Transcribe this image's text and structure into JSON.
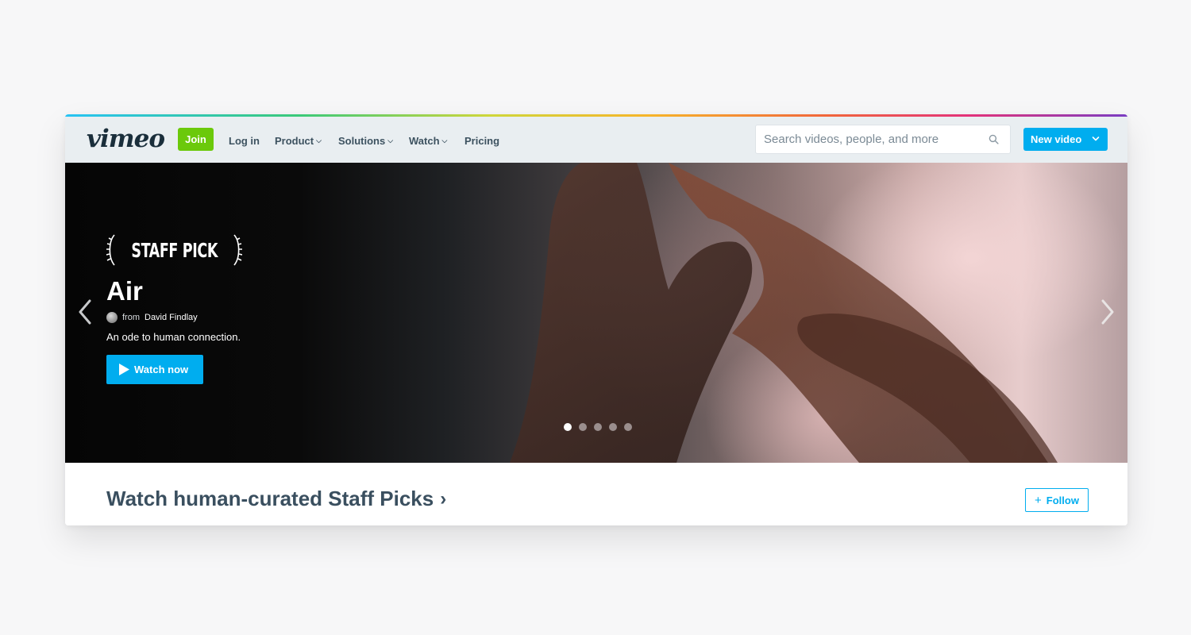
{
  "header": {
    "logo": "vimeo",
    "join_label": "Join",
    "nav": [
      {
        "label": "Log in"
      },
      {
        "label": "Product",
        "has_chevron": true
      },
      {
        "label": "Solutions",
        "has_chevron": true
      },
      {
        "label": "Watch",
        "has_chevron": true
      },
      {
        "label": "Pricing"
      }
    ],
    "search_placeholder": "Search videos, people, and more",
    "new_video_label": "New video"
  },
  "hero": {
    "badge": "STAFF PICK",
    "title": "Air",
    "byline_prefix": "from",
    "author": "David Findlay",
    "description": "An ode to human connection.",
    "watch_label": "Watch now",
    "carousel": {
      "total": 5,
      "active_index": 0
    }
  },
  "section": {
    "title": "Watch human-curated Staff Picks",
    "chevron": "›",
    "follow_plus": "+",
    "follow_label": "Follow"
  },
  "colors": {
    "join_green": "#6bc90b",
    "vimeo_blue": "#00adef",
    "nav_text": "#3d5260",
    "header_bg": "#e9eef1"
  },
  "icons": {
    "search": "search-icon",
    "play": "play-icon",
    "prev": "chevron-left-icon",
    "next": "chevron-right-icon",
    "dropdown": "chevron-down-icon"
  }
}
